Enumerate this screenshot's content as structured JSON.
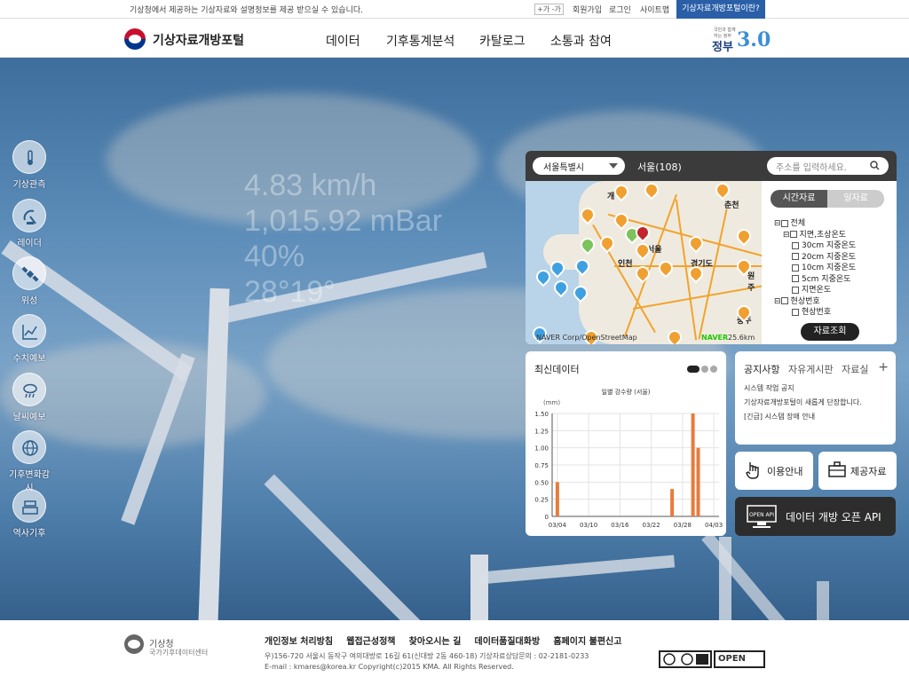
{
  "topbar": {
    "notice": "기상청에서 제공하는 기상자료와 설명정보를 제공 받으실 수 있습니다.",
    "font_control": "+가 -가",
    "links": [
      "회원가입",
      "로그인",
      "사이트맵"
    ],
    "portal_button": "기상자료개방포털이란?"
  },
  "header": {
    "logo_text": "기상자료개방포털",
    "nav": [
      "데이터",
      "기후통계분석",
      "카탈로그",
      "소통과 참여"
    ],
    "gov_small": "국민과 함께하는 정부",
    "gov_word": "정부",
    "gov_number": "3.0"
  },
  "hero": {
    "weather_lines": [
      "4.83 km/h",
      "1,015.92 mBar",
      "40%",
      "28°19°"
    ]
  },
  "sidebar": {
    "items": [
      {
        "label": "기상관측",
        "icon": "thermometer-icon"
      },
      {
        "label": "레이더",
        "icon": "radar-icon"
      },
      {
        "label": "위성",
        "icon": "satellite-icon"
      },
      {
        "label": "수치예보",
        "icon": "line-chart-icon"
      },
      {
        "label": "날씨예보",
        "icon": "cloud-rain-icon"
      },
      {
        "label": "기후변화감시",
        "icon": "globe-icon"
      },
      {
        "label": "역사기후",
        "icon": "archive-icon"
      }
    ]
  },
  "map_panel": {
    "region": "서울특별시",
    "station": "서울(108)",
    "address_placeholder": "주소를 입력하세요.",
    "map_labels": [
      "개",
      "서울",
      "인천",
      "경기도",
      "춘천",
      "원주",
      "충주"
    ],
    "credit": "NAVER Corp/OpenStreetMap",
    "naver": "NAVER",
    "scale": "25.6km",
    "tabs": [
      "시간자료",
      "일자료"
    ],
    "tree": [
      "전체",
      "지면,초상온도",
      "30cm 지중온도",
      "20cm 지중온도",
      "10cm 지중온도",
      "5cm 지중온도",
      "지면온도",
      "현상번호",
      "현상번호"
    ],
    "view_button": "자료조회"
  },
  "latest": {
    "title": "최신데이터",
    "chart_title": "일별 강수량 (서울)",
    "unit": "(mm)"
  },
  "chart_data": {
    "type": "bar",
    "title": "일별 강수량 (서울)",
    "ylabel": "(mm)",
    "ylim": [
      0,
      1.5
    ],
    "yticks": [
      "0",
      "0.25",
      "0.50",
      "0.75",
      "1.00",
      "1.25",
      "1.50"
    ],
    "xticks": [
      "03/04",
      "03/10",
      "03/16",
      "03/22",
      "03/28",
      "04/03"
    ],
    "x": [
      "03/04",
      "03/26",
      "03/30",
      "03/31"
    ],
    "values": [
      0.5,
      0.4,
      1.6,
      1.0
    ],
    "grid": true,
    "color": "#e87b3c"
  },
  "notice_panel": {
    "tabs": [
      "공지사항",
      "자유게시판",
      "자료실"
    ],
    "plus": "+",
    "items": [
      "시스템 작업 공지",
      "기상자료개방포털이 새롭게 단장합니다.",
      "[긴급] 시스템 장애 안내"
    ]
  },
  "quick": {
    "guide": "이용안내",
    "provided": "제공자료",
    "api": "데이터 개방 오픈 API",
    "api_badge": "OPEN API"
  },
  "footer": {
    "org1": "기상청",
    "org2": "국가기후데이터센터",
    "links": [
      "개인정보 처리방침",
      "웹접근성정책",
      "찾아오시는 길",
      "데이터품질대화방",
      "홈페이지 불편신고"
    ],
    "address": "우)156-720 서울시 동작구 여의대방로 16길 61(신대방 2동 460-18)   기상자료상담문의 : 02-2181-0233",
    "copyright": "E-mail : kmares@korea.kr   Copyright(c)2015 KMA. All Rights Reserved.",
    "open_badge": "OPEN"
  },
  "colors": {
    "accent": "#2a5fa8",
    "bar": "#e87b3c",
    "panel_dark": "#2d2d2d"
  }
}
